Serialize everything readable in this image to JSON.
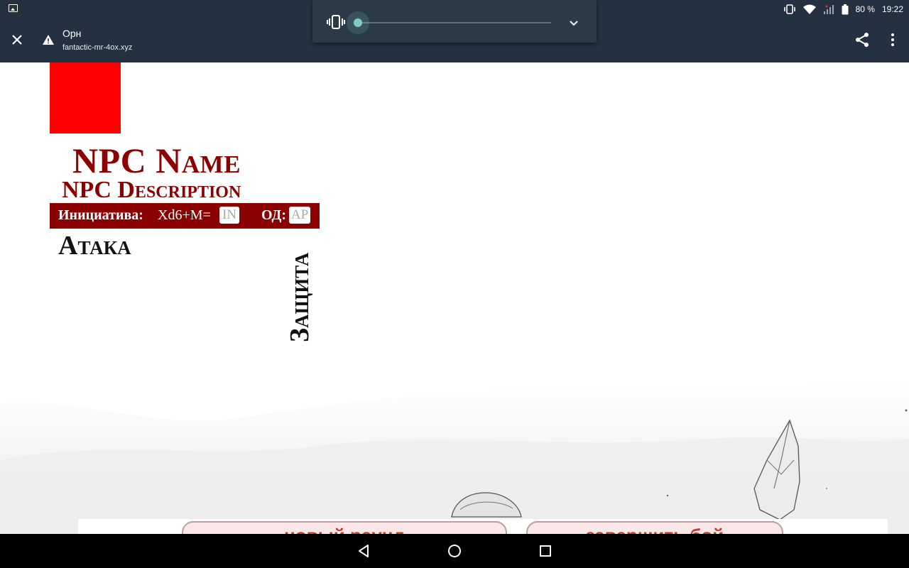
{
  "status_bar": {
    "battery": "80 %",
    "time": "19:22",
    "icons": [
      "gallery-icon",
      "vibrate-icon",
      "wifi-icon",
      "signal-icon",
      "battery-icon"
    ]
  },
  "browser": {
    "title": "Орн",
    "url": "fantactic-mr-4ox.xyz",
    "icons": [
      "close-icon",
      "warning-icon",
      "share-icon",
      "more-vert-icon"
    ]
  },
  "volume": {
    "mode_icon": "vibrate-icon",
    "level": 0,
    "expand_icon": "chevron-down-icon"
  },
  "npc": {
    "name": "NPC Name",
    "description": "NPC Description",
    "portrait_color": "#ff0000"
  },
  "initiative": {
    "label": "Инициатива:",
    "formula": "Xd6+M=",
    "value_placeholder": "IN",
    "ap_label": "ОД:",
    "ap_placeholder": "AP"
  },
  "sections": {
    "attack": "Атака",
    "defense": "Защита"
  },
  "buttons": {
    "new_round": "новый раунд",
    "end_fight": "завершить бой"
  },
  "nav": {
    "icons": [
      "back-icon",
      "home-icon",
      "recents-icon"
    ]
  },
  "colors": {
    "accent": "#8b0000",
    "chrome": "#243140",
    "button_text": "#c0392b"
  }
}
